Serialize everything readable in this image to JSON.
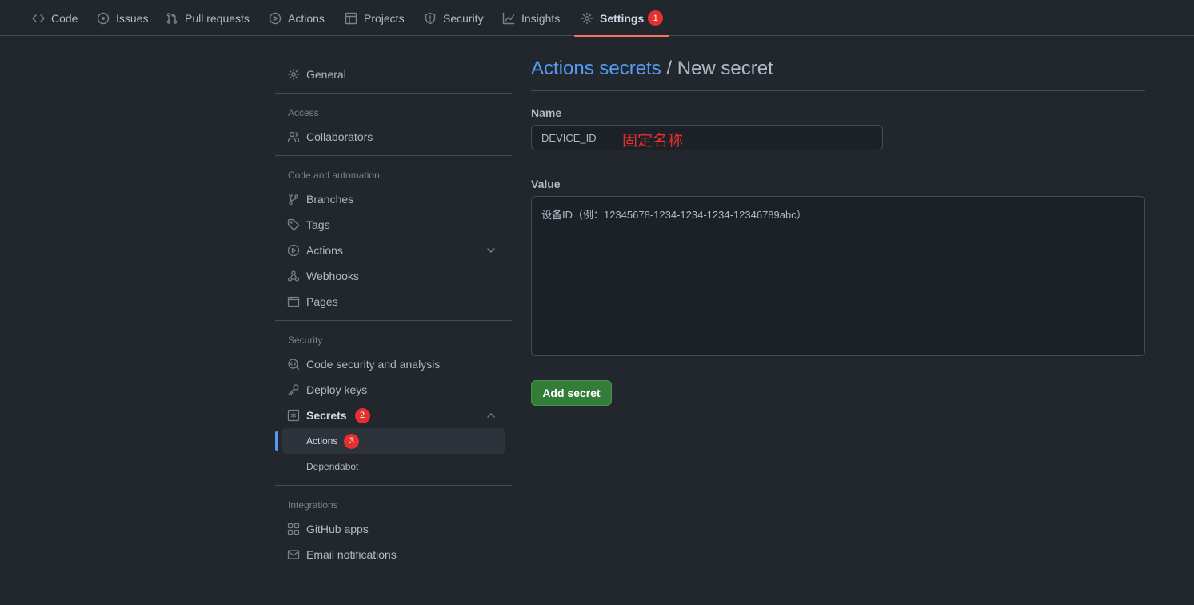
{
  "topnav": {
    "tabs": [
      {
        "label": "Code",
        "icon": "code-icon"
      },
      {
        "label": "Issues",
        "icon": "issue-icon"
      },
      {
        "label": "Pull requests",
        "icon": "pull-request-icon"
      },
      {
        "label": "Actions",
        "icon": "play-icon"
      },
      {
        "label": "Projects",
        "icon": "table-icon"
      },
      {
        "label": "Security",
        "icon": "shield-icon"
      },
      {
        "label": "Insights",
        "icon": "graph-icon"
      },
      {
        "label": "Settings",
        "icon": "gear-icon",
        "active": true,
        "badge": "1"
      }
    ],
    "accent_color": "#ec775c"
  },
  "sidebar": {
    "general": "General",
    "access_heading": "Access",
    "collaborators": "Collaborators",
    "code_heading": "Code and automation",
    "branches": "Branches",
    "tags": "Tags",
    "actions": "Actions",
    "webhooks": "Webhooks",
    "pages": "Pages",
    "security_heading": "Security",
    "code_security": "Code security and analysis",
    "deploy_keys": "Deploy keys",
    "secrets": "Secrets",
    "secrets_badge": "2",
    "secrets_actions": "Actions",
    "secrets_actions_badge": "3",
    "dependabot": "Dependabot",
    "integrations_heading": "Integrations",
    "github_apps": "GitHub apps",
    "email_notifications": "Email notifications"
  },
  "main": {
    "breadcrumb_link": "Actions secrets",
    "breadcrumb_sep": " / ",
    "title": "New secret",
    "name_label": "Name",
    "name_value": "DEVICE_ID",
    "name_annotation": "固定名称",
    "value_label": "Value",
    "value_text": "设备ID（例：12345678-1234-1234-1234-12346789abc）",
    "add_button": "Add secret"
  },
  "colors": {
    "background": "#22272e",
    "link": "#539bf5",
    "badge": "#e5302f",
    "button": "#347d39"
  }
}
